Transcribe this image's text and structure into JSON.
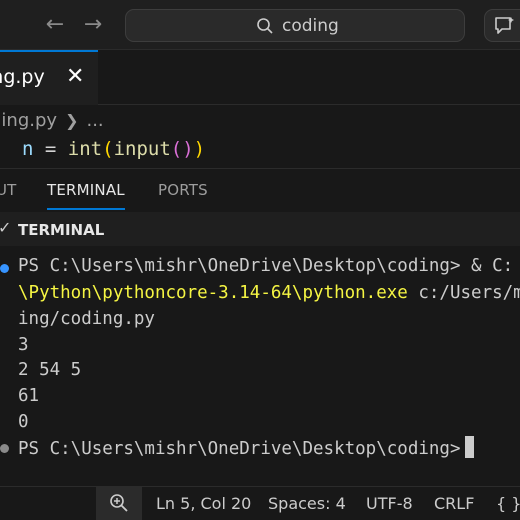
{
  "titlebar": {
    "back_icon": "arrow-left-icon",
    "forward_icon": "arrow-right-icon",
    "search_text": "coding"
  },
  "editor": {
    "tab_label": "ing.py",
    "breadcrumb_file": "ding.py",
    "breadcrumb_more": "...",
    "code": {
      "var": "n",
      "op": " = ",
      "fn1": "int",
      "p1o": "(",
      "fn2": "input",
      "p2": "()",
      "p1c": ")"
    }
  },
  "panel": {
    "tabs": [
      "UT",
      "TERMINAL",
      "PORTS"
    ],
    "section_title": "TERMINAL"
  },
  "terminal": {
    "line1_prompt": "PS C:\\Users\\mishr\\OneDrive\\Desktop\\coding> ",
    "line1_cmd": "& C:",
    "line2_path": "\\Python\\pythoncore-3.14-64\\python.exe",
    "line2_arg": " c:/Users/m",
    "line3": "ing/coding.py",
    "outputs": [
      "3",
      "2 54 5",
      "61",
      "0"
    ],
    "last_prompt": "PS C:\\Users\\mishr\\OneDrive\\Desktop\\coding>",
    "dot_color_run": "#3794ff",
    "dot_color_idle": "#8a8a8a"
  },
  "statusbar": {
    "position": "Ln 5, Col 20",
    "spaces": "Spaces: 4",
    "encoding": "UTF-8",
    "eol": "CRLF",
    "language_glyph": "{ }"
  }
}
